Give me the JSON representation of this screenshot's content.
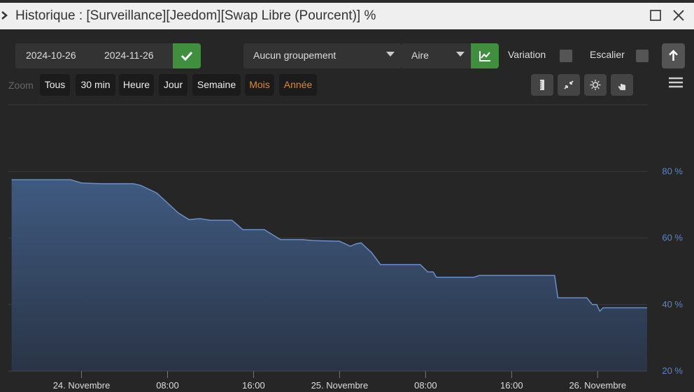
{
  "window": {
    "title": "Historique : [Surveillance][Jeedom][Swap Libre (Pourcent)] %",
    "close_label": "✕"
  },
  "toolbar": {
    "start_date": "2024-10-26",
    "end_date": "2024-11-26",
    "grouping": "Aucun groupement",
    "chart_type_select": "Aire",
    "variation_label": "Variation",
    "escalier_label": "Escalier",
    "zoom_label": "Zoom",
    "zoom_buttons": [
      "Tous",
      "30 min",
      "Heure",
      "Jour",
      "Semaine",
      "Mois",
      "Année"
    ],
    "zoom_disabled_color": "#d98a30"
  },
  "colors": {
    "accent_green": "#3f8f3f",
    "area_line": "#6a8fc8",
    "area_fill_top": "#3f5a80",
    "area_fill_bottom": "#2a3446",
    "axis_label": "#5a85c8"
  },
  "chart_data": {
    "type": "area",
    "title": "",
    "xlabel": "",
    "ylabel": "",
    "x_ticks": [
      "24. Novembre",
      "08:00",
      "16:00",
      "25. Novembre",
      "08:00",
      "16:00",
      "26. Novembre"
    ],
    "x_tick_hours": [
      0,
      8,
      16,
      24,
      32,
      40,
      48
    ],
    "y_ticks": [
      "20 %",
      "40 %",
      "60 %",
      "80 %"
    ],
    "y_tick_values": [
      20,
      40,
      60,
      80
    ],
    "ylim": [
      20,
      100
    ],
    "xlim_hours": [
      -6.8,
      52.6
    ],
    "grid": true,
    "points": [
      [
        -6.5,
        77.5
      ],
      [
        -1.0,
        77.5
      ],
      [
        0.0,
        76.5
      ],
      [
        1.8,
        76.3
      ],
      [
        4.8,
        76.3
      ],
      [
        5.5,
        75.8
      ],
      [
        7.0,
        73.5
      ],
      [
        8.0,
        70.5
      ],
      [
        9.0,
        67.5
      ],
      [
        10.0,
        65.5
      ],
      [
        11.0,
        65.8
      ],
      [
        12.0,
        65.3
      ],
      [
        14.0,
        65.3
      ],
      [
        15.0,
        62.5
      ],
      [
        17.0,
        62.5
      ],
      [
        18.5,
        59.5
      ],
      [
        20.5,
        59.5
      ],
      [
        21.5,
        59.2
      ],
      [
        24.0,
        59.0
      ],
      [
        25.0,
        57.5
      ],
      [
        25.5,
        58.2
      ],
      [
        26.0,
        58.5
      ],
      [
        27.0,
        55.5
      ],
      [
        27.8,
        52.0
      ],
      [
        31.5,
        52.0
      ],
      [
        32.2,
        49.8
      ],
      [
        32.7,
        49.8
      ],
      [
        33.0,
        48.2
      ],
      [
        36.5,
        48.2
      ],
      [
        37.0,
        48.7
      ],
      [
        44.0,
        48.7
      ],
      [
        44.3,
        42.0
      ],
      [
        47.0,
        42.0
      ],
      [
        47.5,
        40.0
      ],
      [
        47.9,
        40.0
      ],
      [
        48.2,
        38.0
      ],
      [
        48.5,
        39.0
      ],
      [
        52.6,
        39.0
      ]
    ]
  }
}
